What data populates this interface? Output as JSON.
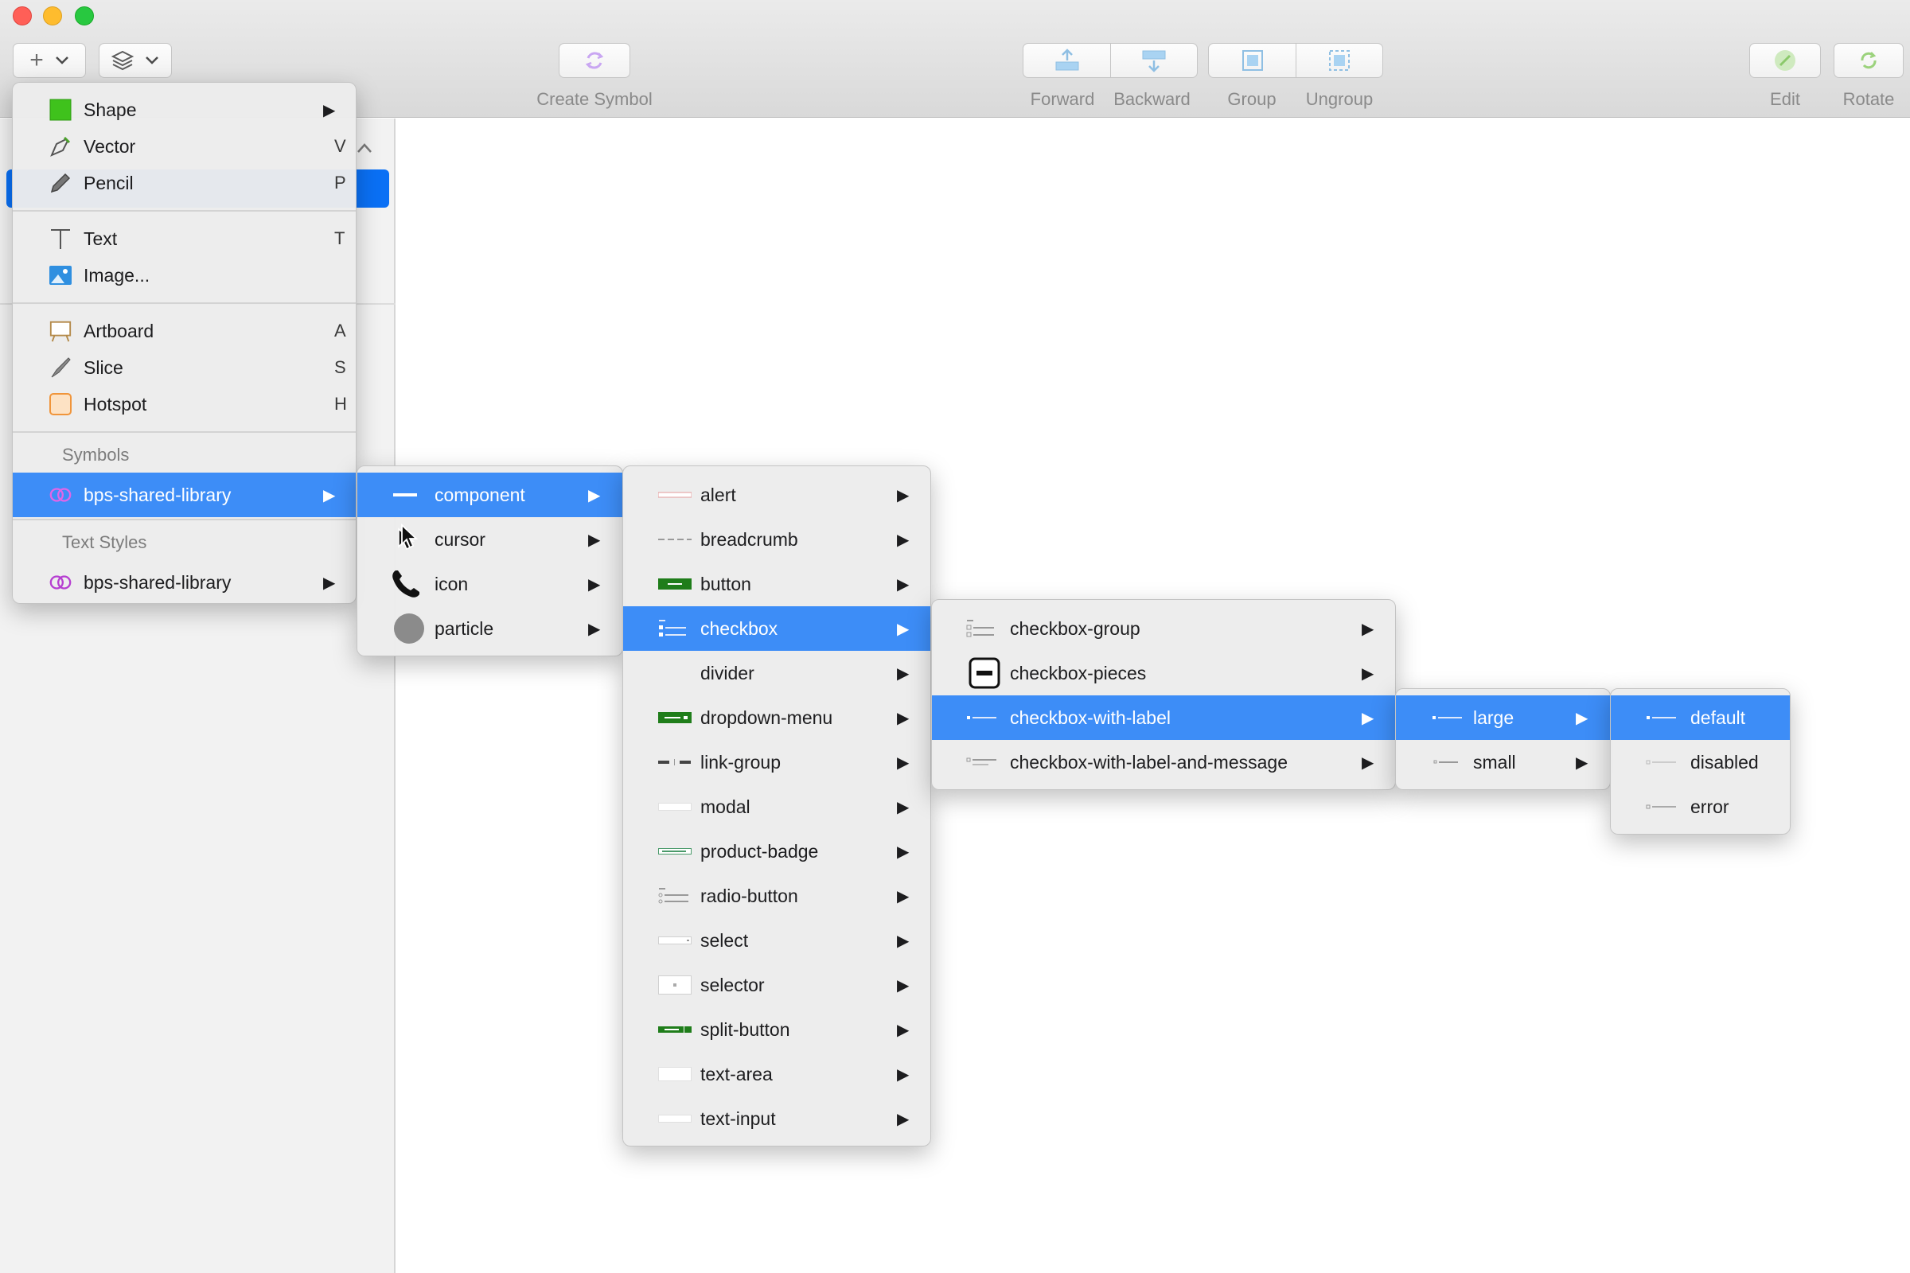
{
  "toolbar": {
    "create_symbol": "Create Symbol",
    "forward": "Forward",
    "backward": "Backward",
    "group": "Group",
    "ungroup": "Ungroup",
    "edit": "Edit",
    "rotate": "Rotate"
  },
  "insert_menu": {
    "shape": {
      "label": "Shape"
    },
    "vector": {
      "label": "Vector",
      "shortcut": "V"
    },
    "pencil": {
      "label": "Pencil",
      "shortcut": "P"
    },
    "text": {
      "label": "Text",
      "shortcut": "T"
    },
    "image": {
      "label": "Image..."
    },
    "artboard": {
      "label": "Artboard",
      "shortcut": "A"
    },
    "slice": {
      "label": "Slice",
      "shortcut": "S"
    },
    "hotspot": {
      "label": "Hotspot",
      "shortcut": "H"
    },
    "symbols_header": "Symbols",
    "symbols_library": "bps-shared-library",
    "text_styles_header": "Text Styles",
    "text_styles_library": "bps-shared-library"
  },
  "library_menu": {
    "items": [
      "component",
      "cursor",
      "icon",
      "particle"
    ]
  },
  "component_menu": {
    "items": [
      "alert",
      "breadcrumb",
      "button",
      "checkbox",
      "divider",
      "dropdown-menu",
      "link-group",
      "modal",
      "product-badge",
      "radio-button",
      "select",
      "selector",
      "split-button",
      "text-area",
      "text-input"
    ]
  },
  "checkbox_menu": {
    "items": [
      "checkbox-group",
      "checkbox-pieces",
      "checkbox-with-label",
      "checkbox-with-label-and-message"
    ]
  },
  "size_menu": {
    "items": [
      "large",
      "small"
    ]
  },
  "state_menu": {
    "items": [
      "default",
      "disabled",
      "error"
    ]
  },
  "colors": {
    "selection": "#3d8df7",
    "sidebar_selection": "#0a70f5",
    "button_green": "#1f7d1a"
  }
}
